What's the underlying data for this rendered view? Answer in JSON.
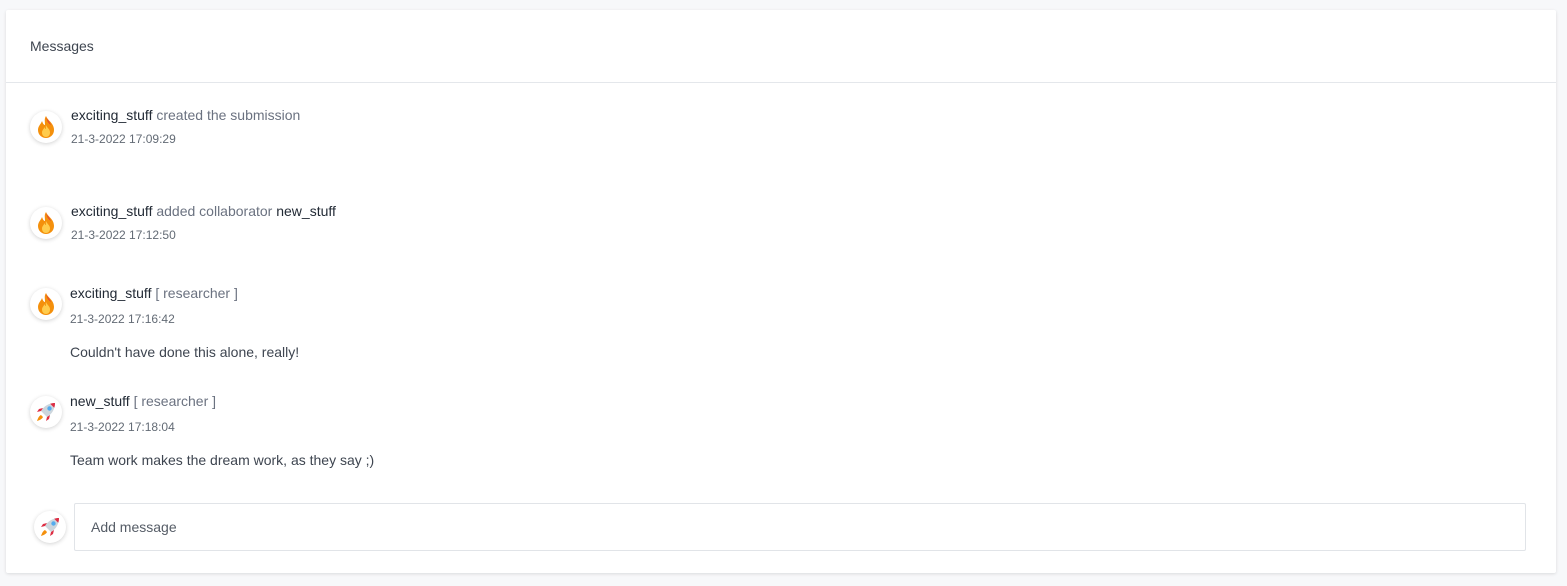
{
  "panel": {
    "title": "Messages"
  },
  "icons": {
    "fire": "fire-icon",
    "rocket": "rocket-icon"
  },
  "messages": [
    {
      "avatar_icon": "fire-icon",
      "user": "exciting_stuff",
      "action": "created the submission",
      "timestamp": "21-3-2022 17:09:29"
    },
    {
      "avatar_icon": "fire-icon",
      "user": "exciting_stuff",
      "action": "added collaborator",
      "target": "new_stuff",
      "timestamp": "21-3-2022 17:12:50"
    },
    {
      "avatar_icon": "fire-icon",
      "user": "exciting_stuff",
      "role": "[ researcher ]",
      "timestamp": "21-3-2022 17:16:42",
      "text": "Couldn't have done this alone, really!"
    },
    {
      "avatar_icon": "rocket-icon",
      "user": "new_stuff",
      "role": "[ researcher ]",
      "timestamp": "21-3-2022 17:18:04",
      "text": "Team work makes the dream work, as they say ;)"
    }
  ],
  "composer": {
    "avatar_icon": "rocket-icon",
    "placeholder": "Add message",
    "value": ""
  }
}
